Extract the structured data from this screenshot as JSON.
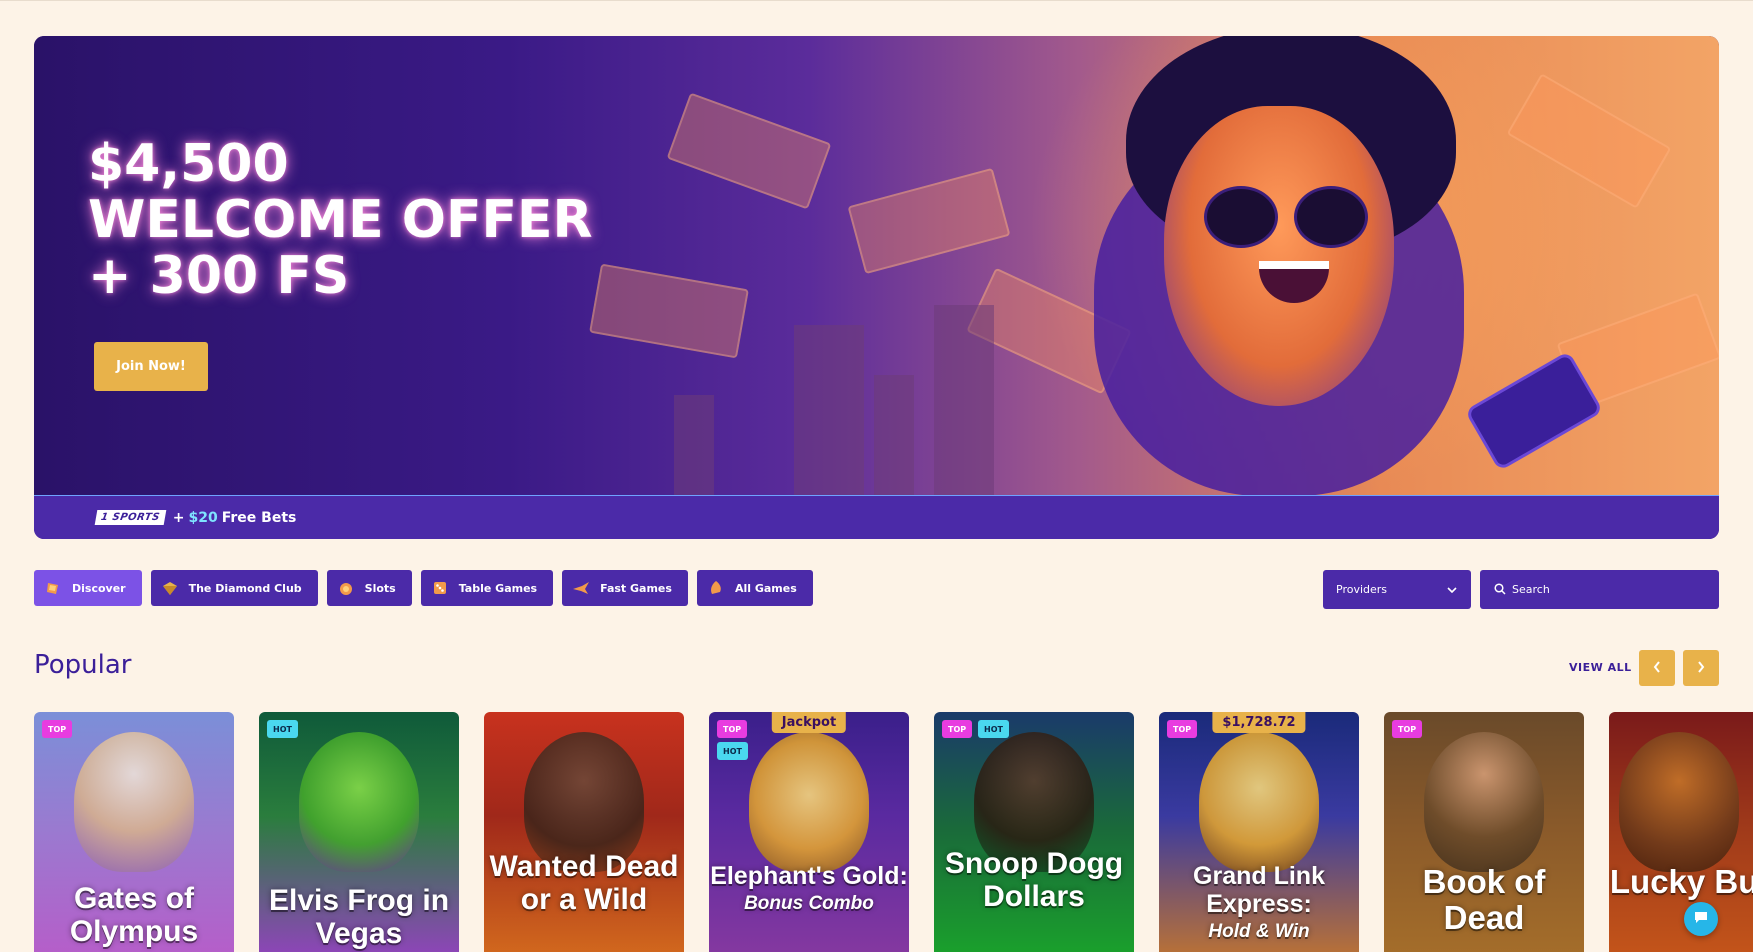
{
  "hero": {
    "title_line1": "$4,500",
    "title_line2": "WELCOME OFFER",
    "title_line3": "+ 300 FS",
    "cta_label": "Join Now!",
    "bar": {
      "logo_text": "1 SPORTS",
      "plus": "+",
      "amount": "$20",
      "text": "Free Bets"
    }
  },
  "categories": [
    {
      "label": "Discover",
      "icon": "discover-icon",
      "active": true
    },
    {
      "label": "The Diamond Club",
      "icon": "diamond-icon",
      "active": false
    },
    {
      "label": "Slots",
      "icon": "slots-icon",
      "active": false
    },
    {
      "label": "Table Games",
      "icon": "table-games-icon",
      "active": false
    },
    {
      "label": "Fast Games",
      "icon": "fast-games-icon",
      "active": false
    },
    {
      "label": "All Games",
      "icon": "all-games-icon",
      "active": false
    }
  ],
  "filters": {
    "providers_label": "Providers",
    "search_placeholder": "Search"
  },
  "popular": {
    "title": "Popular",
    "view_all": "VIEW ALL",
    "games": [
      {
        "title": "Gates of Olympus",
        "subtitle": "",
        "badges": [
          "TOP"
        ],
        "jackpot": ""
      },
      {
        "title": "Elvis Frog in Vegas",
        "subtitle": "",
        "badges": [
          "HOT"
        ],
        "jackpot": ""
      },
      {
        "title": "Wanted Dead or a Wild",
        "subtitle": "",
        "badges": [],
        "jackpot": ""
      },
      {
        "title": "Elephant's Gold:",
        "subtitle": "Bonus Combo",
        "badges": [
          "TOP",
          "HOT"
        ],
        "jackpot": "Jackpot"
      },
      {
        "title": "Snoop Dogg Dollars",
        "subtitle": "",
        "badges": [
          "TOP",
          "HOT"
        ],
        "jackpot": ""
      },
      {
        "title": "Grand Link Express:",
        "subtitle": "Hold & Win",
        "badges": [
          "TOP"
        ],
        "jackpot": "$1,728.72"
      },
      {
        "title": "Book of Dead",
        "subtitle": "",
        "badges": [
          "TOP"
        ],
        "jackpot": ""
      },
      {
        "title": "Lucky Buffalo",
        "subtitle": "",
        "badges": [],
        "jackpot": ""
      }
    ]
  },
  "colors": {
    "page_bg": "#fdf3e7",
    "primary": "#4b2aa8",
    "accent": "#e8b24a",
    "badge_top": "#e83ce0",
    "badge_hot": "#4ad8ef"
  }
}
